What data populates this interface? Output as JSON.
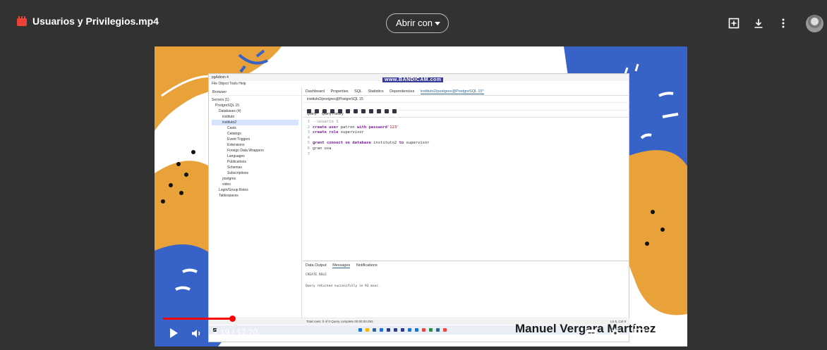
{
  "topbar": {
    "file_title": "Usuarios y Privilegios.mp4",
    "open_with_label": "Abrir con"
  },
  "video": {
    "watermark": "Manuel Vergara Martínez",
    "recorder_watermark": "www.BANDICAM.com",
    "time_label": "2:19 / 17:20",
    "progress_fraction": 0.134
  },
  "pgadmin": {
    "app_title": "pgAdmin 4",
    "menu": "File  Object  Tools  Help",
    "browser_label": "Browser",
    "tree": [
      "Servers (1)",
      "PostgreSQL 15",
      "Databases (4)",
      "instituto",
      "instituto2",
      "Casts",
      "Catalogs",
      "Event Triggers",
      "Extensions",
      "Foreign Data Wrappers",
      "Languages",
      "Publications",
      "Schemas",
      "Subscriptions",
      "postgres",
      "video",
      "Login/Group Roles",
      "Tablespaces"
    ],
    "tabs": [
      "Dashboard",
      "Properties",
      "SQL",
      "Statistics",
      "Dependencies",
      "instituto2/postgres@PostgreSQL 15*"
    ],
    "query_path": "instituto2/postgres@PostgreSQL 15",
    "query_tabs": [
      "Query",
      "Query History"
    ],
    "line_numbers": "1\n2\n3\n4\n5\n6\n7",
    "result_tabs": [
      "Data Output",
      "Messages",
      "Notifications"
    ],
    "message_1": "CREATE ROLE",
    "message_2": "Query returned successfully in 93 msec.",
    "status_left": "Total rows: 0 of 0    Query complete 00:00:00.093",
    "status_right": "Ln 6, Col 9"
  },
  "colors": {
    "accent_red": "#ff0000",
    "brand_pg": "#326690"
  }
}
